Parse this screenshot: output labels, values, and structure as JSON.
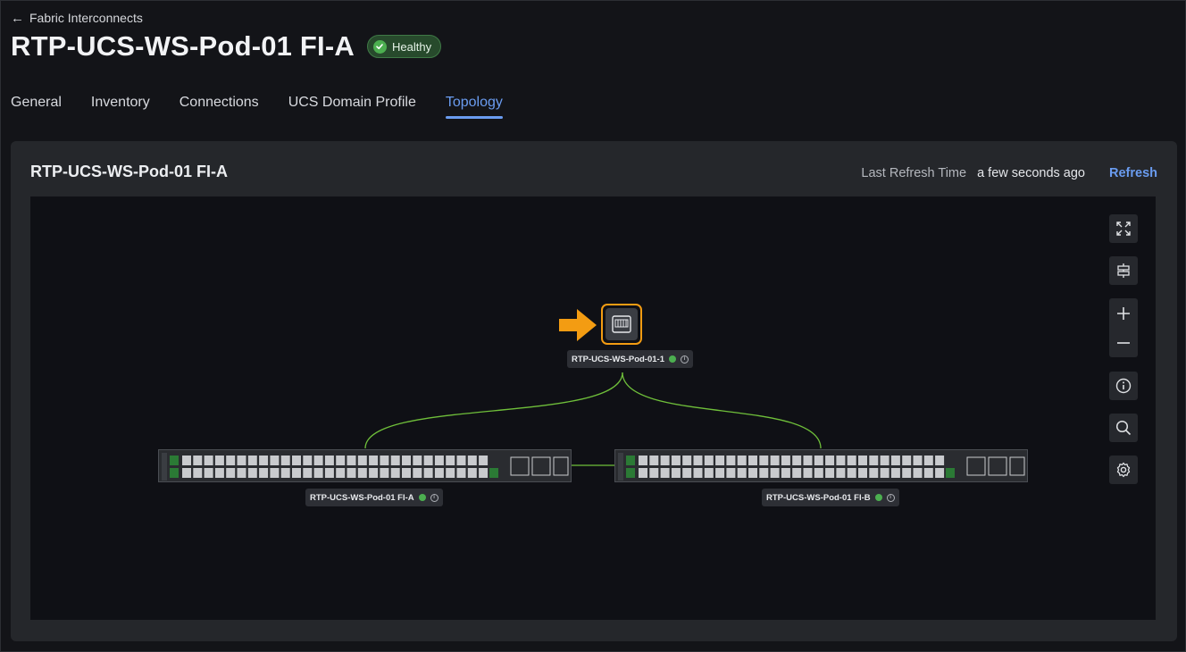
{
  "breadcrumb": {
    "back_label": "Fabric Interconnects"
  },
  "header": {
    "title": "RTP-UCS-WS-Pod-01 FI-A",
    "status_badge": "Healthy",
    "status_color": "#4caf50"
  },
  "tabs": [
    {
      "label": "General",
      "active": false
    },
    {
      "label": "Inventory",
      "active": false
    },
    {
      "label": "Connections",
      "active": false
    },
    {
      "label": "UCS Domain Profile",
      "active": false
    },
    {
      "label": "Topology",
      "active": true
    }
  ],
  "panel": {
    "title": "RTP-UCS-WS-Pod-01 FI-A",
    "refresh_label": "Last Refresh Time",
    "refresh_value": "a few seconds ago",
    "refresh_button": "Refresh"
  },
  "topology": {
    "chassis_node": {
      "label": "RTP-UCS-WS-Pod-01-1",
      "status": "healthy",
      "highlight_color": "#f39c12"
    },
    "fi_a": {
      "label": "RTP-UCS-WS-Pod-01 FI-A",
      "status": "healthy"
    },
    "fi_b": {
      "label": "RTP-UCS-WS-Pod-01 FI-B",
      "status": "healthy"
    },
    "link_color": "#6fbf3a"
  },
  "toolbar": {
    "icons": [
      "expand-icon",
      "align-icon",
      "zoom-in-icon",
      "zoom-out-icon",
      "info-icon",
      "search-icon",
      "settings-icon"
    ]
  },
  "accent_color": "#6a9cf0"
}
